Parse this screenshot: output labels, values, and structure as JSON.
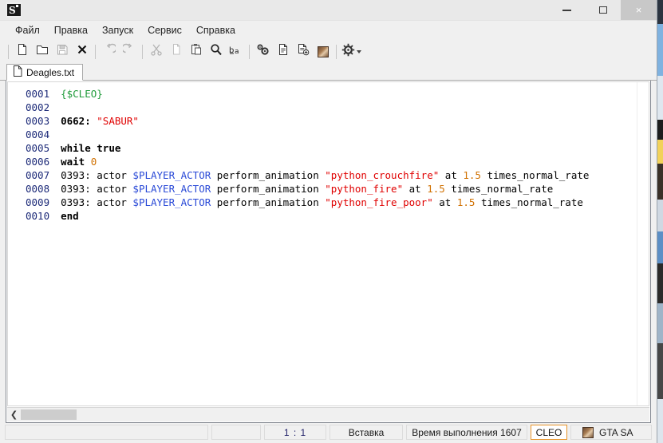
{
  "window": {
    "app_icon": "sanny-builder-icon",
    "controls": {
      "minimize": "minimize-icon",
      "maximize": "maximize-icon",
      "close": "×"
    }
  },
  "menubar": {
    "items": [
      {
        "label": "Файл",
        "name": "menu-file"
      },
      {
        "label": "Правка",
        "name": "menu-edit"
      },
      {
        "label": "Запуск",
        "name": "menu-run"
      },
      {
        "label": "Сервис",
        "name": "menu-tools"
      },
      {
        "label": "Справка",
        "name": "menu-help"
      }
    ]
  },
  "toolbar": {
    "buttons": [
      {
        "name": "new-file-icon",
        "enabled": true
      },
      {
        "name": "open-file-icon",
        "enabled": true
      },
      {
        "name": "save-file-icon",
        "enabled": false
      },
      {
        "name": "close-file-icon",
        "enabled": true
      },
      {
        "name": "undo-icon",
        "enabled": false
      },
      {
        "name": "redo-icon",
        "enabled": false
      },
      {
        "name": "cut-icon",
        "enabled": false
      },
      {
        "name": "copy-icon",
        "enabled": false
      },
      {
        "name": "paste-icon",
        "enabled": true
      },
      {
        "name": "find-icon",
        "enabled": true
      },
      {
        "name": "replace-icon",
        "enabled": true
      },
      {
        "name": "compile-icon",
        "enabled": true
      },
      {
        "name": "document-icon",
        "enabled": true
      },
      {
        "name": "add-document-icon",
        "enabled": true
      },
      {
        "name": "gta-sa-icon",
        "enabled": true
      },
      {
        "name": "settings-gear-icon",
        "enabled": true
      }
    ]
  },
  "tabs": [
    {
      "label": "Deagles.txt",
      "icon": "file-icon",
      "active": true
    }
  ],
  "editor": {
    "lines": [
      {
        "no": "0001",
        "tokens": [
          {
            "t": "{$CLEO}",
            "c": "dir"
          }
        ]
      },
      {
        "no": "0002",
        "tokens": []
      },
      {
        "no": "0003",
        "tokens": [
          {
            "t": "0662:",
            "c": "op"
          },
          {
            "t": " ",
            "c": "txt"
          },
          {
            "t": "\"SABUR\"",
            "c": "str"
          }
        ]
      },
      {
        "no": "0004",
        "tokens": []
      },
      {
        "no": "0005",
        "tokens": [
          {
            "t": "while true",
            "c": "kw"
          }
        ]
      },
      {
        "no": "0006",
        "tokens": [
          {
            "t": "wait ",
            "c": "kw"
          },
          {
            "t": "0",
            "c": "num"
          }
        ]
      },
      {
        "no": "0007",
        "tokens": [
          {
            "t": "0393: actor ",
            "c": "txt"
          },
          {
            "t": "$PLAYER_ACTOR",
            "c": "var"
          },
          {
            "t": " perform_animation ",
            "c": "txt"
          },
          {
            "t": "\"python_crouchfire\"",
            "c": "str"
          },
          {
            "t": " at ",
            "c": "txt"
          },
          {
            "t": "1.5",
            "c": "num"
          },
          {
            "t": " times_normal_rate",
            "c": "txt"
          }
        ]
      },
      {
        "no": "0008",
        "tokens": [
          {
            "t": "0393: actor ",
            "c": "txt"
          },
          {
            "t": "$PLAYER_ACTOR",
            "c": "var"
          },
          {
            "t": " perform_animation ",
            "c": "txt"
          },
          {
            "t": "\"python_fire\"",
            "c": "str"
          },
          {
            "t": " at ",
            "c": "txt"
          },
          {
            "t": "1.5",
            "c": "num"
          },
          {
            "t": " times_normal_rate",
            "c": "txt"
          }
        ]
      },
      {
        "no": "0009",
        "tokens": [
          {
            "t": "0393: actor ",
            "c": "txt"
          },
          {
            "t": "$PLAYER_ACTOR",
            "c": "var"
          },
          {
            "t": " perform_animation ",
            "c": "txt"
          },
          {
            "t": "\"python_fire_poor\"",
            "c": "str"
          },
          {
            "t": " at ",
            "c": "txt"
          },
          {
            "t": "1.5",
            "c": "num"
          },
          {
            "t": " times_normal_rate",
            "c": "txt"
          }
        ]
      },
      {
        "no": "0010",
        "tokens": [
          {
            "t": "end",
            "c": "kw"
          }
        ]
      }
    ],
    "hscroll": {
      "left_arrow": "❮"
    }
  },
  "statusbar": {
    "blank1": "",
    "blank2": "",
    "position": "1 : 1",
    "mode": "Вставка",
    "exec_time": "Время выполнения 1607",
    "mode_badge": "CLEO",
    "game": "GTA SA",
    "badge_color": "#e8942a"
  },
  "colors": {
    "line_number": "#1c2a78",
    "directive": "#1f9b3a",
    "string": "#e00000",
    "number": "#d07000",
    "variable": "#2a4ad7",
    "keyword": "#000000",
    "window_bg": "#f0f0f0",
    "editor_bg": "#ffffff"
  }
}
